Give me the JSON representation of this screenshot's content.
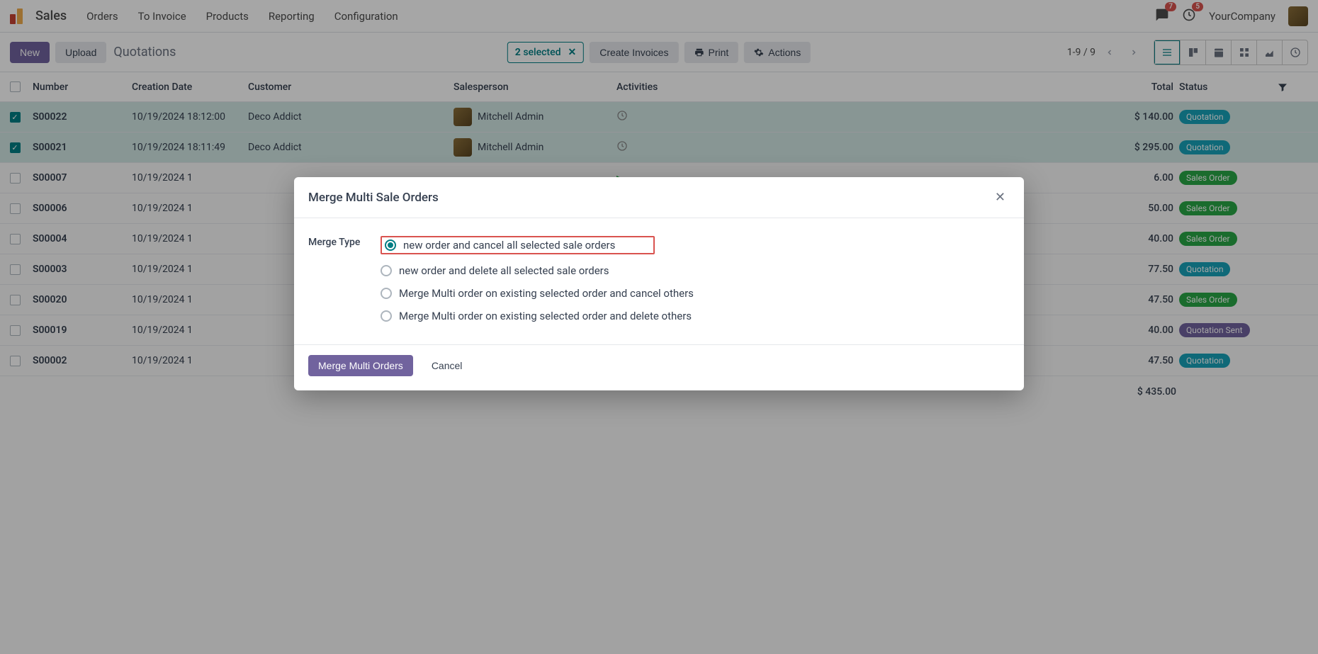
{
  "topnav": {
    "app": "Sales",
    "items": [
      "Orders",
      "To Invoice",
      "Products",
      "Reporting",
      "Configuration"
    ],
    "company": "YourCompany",
    "msg_badge": "7",
    "activity_badge": "5"
  },
  "controlbar": {
    "new_label": "New",
    "upload_label": "Upload",
    "breadcrumb": "Quotations",
    "selected_count": "2",
    "selected_label": "selected",
    "create_invoices": "Create Invoices",
    "print": "Print",
    "actions": "Actions",
    "pager": "1-9 / 9"
  },
  "columns": {
    "number": "Number",
    "creation": "Creation Date",
    "customer": "Customer",
    "salesperson": "Salesperson",
    "activities": "Activities",
    "total": "Total",
    "status": "Status"
  },
  "rows": [
    {
      "selected": true,
      "number": "S00022",
      "date": "10/19/2024 18:12:00",
      "customer": "Deco Addict",
      "salesperson": "Mitchell Admin",
      "activity_icon": "clock",
      "activity_text": "",
      "total": "$ 140.00",
      "status": "Quotation",
      "status_class": "quotation"
    },
    {
      "selected": true,
      "number": "S00021",
      "date": "10/19/2024 18:11:49",
      "customer": "Deco Addict",
      "salesperson": "Mitchell Admin",
      "activity_icon": "clock",
      "activity_text": "",
      "total": "$ 295.00",
      "status": "Quotation",
      "status_class": "quotation"
    },
    {
      "selected": false,
      "number": "S00007",
      "date": "10/19/2024 1",
      "customer": "",
      "salesperson": "",
      "activity_icon": "caret",
      "activity_text": "",
      "total": "6.00",
      "status": "Sales Order",
      "status_class": "salesorder"
    },
    {
      "selected": false,
      "number": "S00006",
      "date": "10/19/2024 1",
      "customer": "",
      "salesperson": "",
      "activity_icon": "",
      "activity_text": "",
      "total": "50.00",
      "status": "Sales Order",
      "status_class": "salesorder"
    },
    {
      "selected": false,
      "number": "S00004",
      "date": "10/19/2024 1",
      "customer": "",
      "salesperson": "",
      "activity_icon": "",
      "activity_text": "",
      "total": "40.00",
      "status": "Sales Order",
      "status_class": "salesorder"
    },
    {
      "selected": false,
      "number": "S00003",
      "date": "10/19/2024 1",
      "customer": "",
      "salesperson": "",
      "activity_icon": "",
      "activity_text": "",
      "total": "77.50",
      "status": "Quotation",
      "status_class": "quotation"
    },
    {
      "selected": false,
      "number": "S00020",
      "date": "10/19/2024 1",
      "customer": "",
      "salesperson": "",
      "activity_icon": "",
      "activity_text": "",
      "total": "47.50",
      "status": "Sales Order",
      "status_class": "salesorder"
    },
    {
      "selected": false,
      "number": "S00019",
      "date": "10/19/2024 1",
      "customer": "",
      "salesperson": "",
      "activity_icon": "",
      "activity_text": "",
      "total": "40.00",
      "status": "Quotation Sent",
      "status_class": "sent"
    },
    {
      "selected": false,
      "number": "S00002",
      "date": "10/19/2024 1",
      "customer": "",
      "salesperson": "",
      "activity_icon": "",
      "activity_text": "",
      "total": "47.50",
      "status": "Quotation",
      "status_class": "quotation"
    }
  ],
  "grand_total": "$ 435.00",
  "modal": {
    "title": "Merge Multi Sale Orders",
    "label": "Merge Type",
    "options": [
      "new order and cancel all selected sale orders",
      "new order and delete all selected sale orders",
      "Merge Multi order on existing selected order and cancel others",
      "Merge Multi order on existing selected order and delete others"
    ],
    "selected_index": 0,
    "merge_btn": "Merge Multi Orders",
    "cancel_btn": "Cancel"
  }
}
